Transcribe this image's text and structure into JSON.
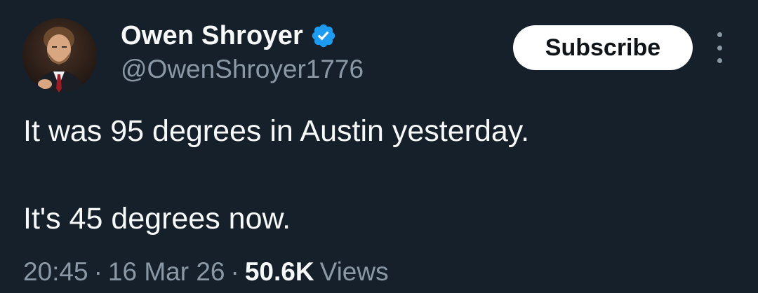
{
  "author": {
    "display_name": "Owen Shroyer",
    "handle": "@OwenShroyer1776",
    "verified": true,
    "verified_color": "#1d9bf0"
  },
  "actions": {
    "subscribe_label": "Subscribe",
    "more_icon": "more-vertical-icon"
  },
  "tweet": {
    "lines": [
      "It was 95 degrees in Austin yesterday.",
      "It's 45 degrees now."
    ]
  },
  "meta": {
    "time": "20:45",
    "separator": "·",
    "date": "16 Mar 26",
    "views_count": "50.6K",
    "views_label": "Views"
  },
  "colors": {
    "background": "#15202b",
    "primary_text": "#f7f9f9",
    "secondary_text": "#8b98a5",
    "button_bg": "#ffffff"
  }
}
